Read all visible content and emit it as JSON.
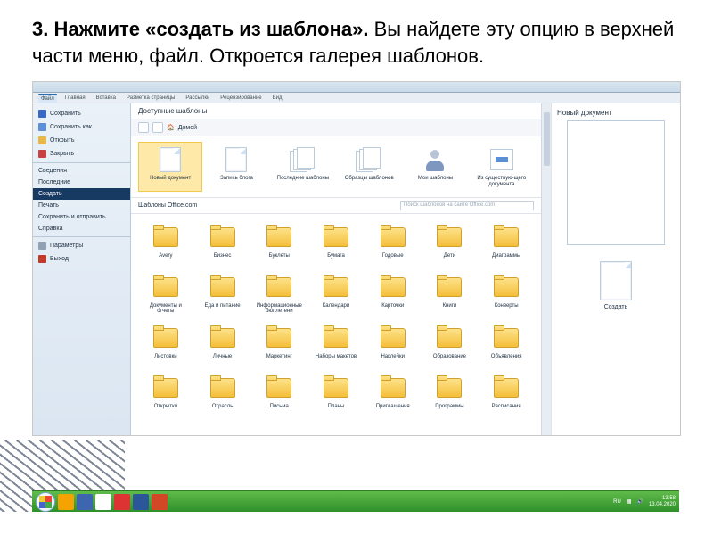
{
  "instruction": {
    "num": "3. ",
    "bold": "Нажмите «создать из шаблона». ",
    "rest": "Вы найдете эту опцию в верхней части меню, файл. Откроется галерея шаблонов."
  },
  "ribbon": {
    "tabs": [
      "Файл",
      "Главная",
      "Вставка",
      "Разметка страницы",
      "Рассылки",
      "Рецензирование",
      "Вид"
    ]
  },
  "sidebar": {
    "items": [
      {
        "label": "Сохранить",
        "icon": "save"
      },
      {
        "label": "Сохранить как",
        "icon": "saveas"
      },
      {
        "label": "Открыть",
        "icon": "open"
      },
      {
        "label": "Закрыть",
        "icon": "close"
      },
      {
        "label": "Сведения",
        "sep": true
      },
      {
        "label": "Последние"
      },
      {
        "label": "Создать",
        "sel": true
      },
      {
        "label": "Печать"
      },
      {
        "label": "Сохранить и отправить"
      },
      {
        "label": "Справка"
      },
      {
        "label": "Параметры",
        "icon": "grey",
        "sep": true
      },
      {
        "label": "Выход",
        "icon": "exit"
      }
    ]
  },
  "templates": {
    "header": "Доступные шаблоны",
    "home": "Домой",
    "top_row": [
      {
        "label": "Новый документ",
        "kind": "doc",
        "sel": true
      },
      {
        "label": "Запись блога",
        "kind": "doc"
      },
      {
        "label": "Последние шаблоны",
        "kind": "multi"
      },
      {
        "label": "Образцы шаблонов",
        "kind": "multi"
      },
      {
        "label": "Мои шаблоны",
        "kind": "person"
      },
      {
        "label": "Из существую-щего документа",
        "kind": "arrow"
      }
    ],
    "office_head": "Шаблоны Office.com",
    "search_placeholder": "Поиск шаблонов на сайте Office.com",
    "folders": [
      "Avery",
      "Бизнес",
      "Буклеты",
      "Бумага",
      "Годовые",
      "Дети",
      "Диаграммы",
      "Документы и отчеты",
      "Еда и питание",
      "Информационные бюллетени",
      "Календари",
      "Карточки",
      "Книги",
      "Конверты",
      "Листовки",
      "Личные",
      "Маркетинг",
      "Наборы макетов",
      "Наклейки",
      "Образование",
      "Объявления",
      "Открытки",
      "Отрасль",
      "Письма",
      "Планы",
      "Приглашения",
      "Программы",
      "Расписания"
    ]
  },
  "preview": {
    "title": "Новый документ",
    "button": "Создать"
  },
  "taskbar": {
    "lang": "RU",
    "time": "13:58",
    "date": "13.04.2020"
  }
}
